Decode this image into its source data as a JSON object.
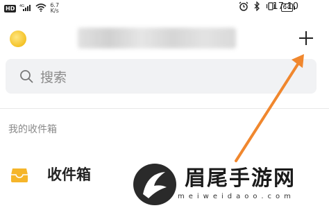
{
  "status_bar": {
    "hd": "HD",
    "signal_label": "4G",
    "speed_value": "6.7",
    "speed_unit": "K/s",
    "battery": "64",
    "time": "17:10"
  },
  "header": {
    "add_label": "+"
  },
  "search": {
    "placeholder": "搜索"
  },
  "section": {
    "title": "我的收件箱"
  },
  "inbox": {
    "label": "收件箱"
  },
  "watermark": {
    "title": "眉尾手游网",
    "url": "meiweidaoo.com"
  },
  "colors": {
    "accent_orange": "#f0872e",
    "avatar_yellow": "#f4c227",
    "inbox_icon": "#f5b52a"
  }
}
